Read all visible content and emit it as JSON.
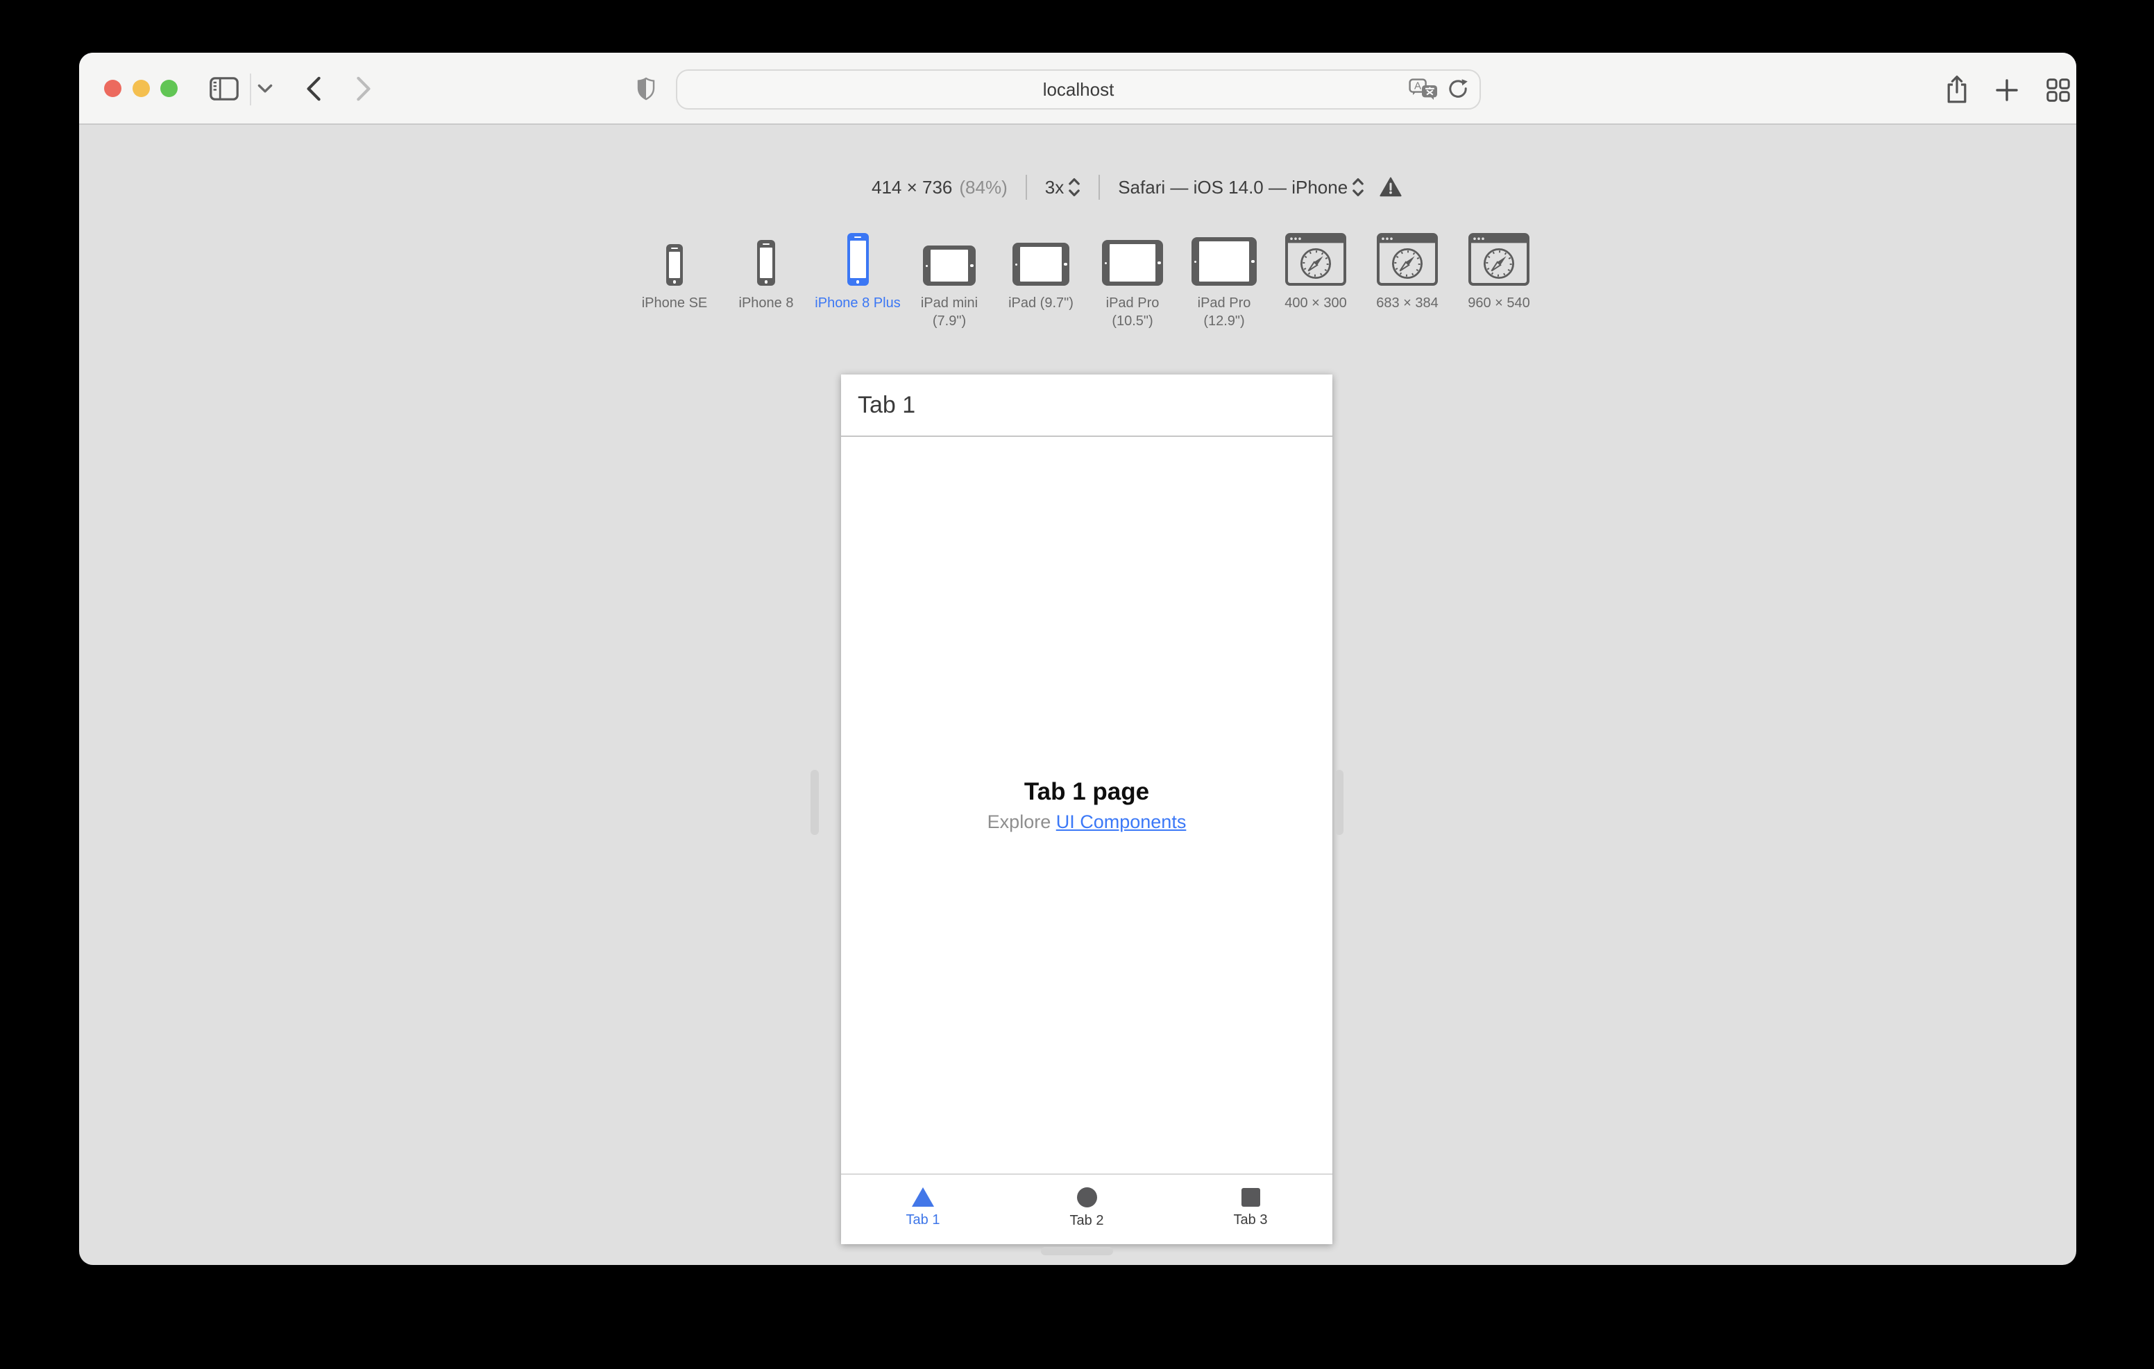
{
  "browser": {
    "url": "localhost",
    "window_controls": {
      "close": "close",
      "minimize": "minimize",
      "zoom": "zoom"
    }
  },
  "rdm": {
    "size_label": "414 × 736",
    "zoom_label": "(84%)",
    "scale_label": "3x",
    "ua_label": "Safari — iOS 14.0 — iPhone",
    "devices": [
      {
        "label": "iPhone SE",
        "selected": false
      },
      {
        "label": "iPhone 8",
        "selected": false
      },
      {
        "label": "iPhone 8 Plus",
        "selected": true
      },
      {
        "label": "iPad mini (7.9\")",
        "selected": false
      },
      {
        "label": "iPad (9.7\")",
        "selected": false
      },
      {
        "label": "iPad Pro (10.5\")",
        "selected": false
      },
      {
        "label": "iPad Pro (12.9\")",
        "selected": false
      },
      {
        "label": "400 × 300",
        "selected": false
      },
      {
        "label": "683 × 384",
        "selected": false
      },
      {
        "label": "960 × 540",
        "selected": false
      }
    ]
  },
  "page": {
    "header_title": "Tab 1",
    "content": {
      "title": "Tab 1 page",
      "subtitle_prefix": "Explore ",
      "link_label": "UI Components"
    },
    "tabs": [
      {
        "label": "Tab 1",
        "active": true
      },
      {
        "label": "Tab 2",
        "active": false
      },
      {
        "label": "Tab 3",
        "active": false
      }
    ]
  },
  "colors": {
    "accent_blue": "#3B77F4",
    "link_blue": "#3B78F7",
    "icon_gray": "#5D5D5D",
    "canvas_gray": "#E0E0E0"
  }
}
